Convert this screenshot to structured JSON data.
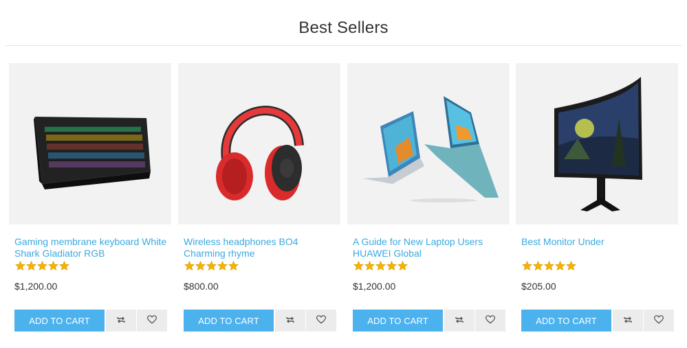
{
  "section": {
    "title": "Best Sellers"
  },
  "products": [
    {
      "name": "Gaming membrane keyboard White Shark Gladiator RGB",
      "rating": 5,
      "price": "$1,200.00",
      "cart_label": "ADD TO CART",
      "compare_icon": "compare-icon",
      "wishlist_icon": "heart-icon"
    },
    {
      "name": "Wireless headphones BO4 Charming rhyme",
      "rating": 5,
      "price": "$800.00",
      "cart_label": "ADD TO CART",
      "compare_icon": "compare-icon",
      "wishlist_icon": "heart-icon"
    },
    {
      "name": "A Guide for New Laptop Users HUAWEI Global",
      "rating": 5,
      "price": "$1,200.00",
      "cart_label": "ADD TO CART",
      "compare_icon": "compare-icon",
      "wishlist_icon": "heart-icon"
    },
    {
      "name": "Best Monitor Under",
      "rating": 5,
      "price": "$205.00",
      "cart_label": "ADD TO CART",
      "compare_icon": "compare-icon",
      "wishlist_icon": "heart-icon"
    }
  ],
  "colors": {
    "accent": "#4cb2ee",
    "link": "#3aa9e0",
    "star": "#f5b301",
    "image_bg": "#f2f2f2",
    "button_secondary": "#ececec"
  }
}
